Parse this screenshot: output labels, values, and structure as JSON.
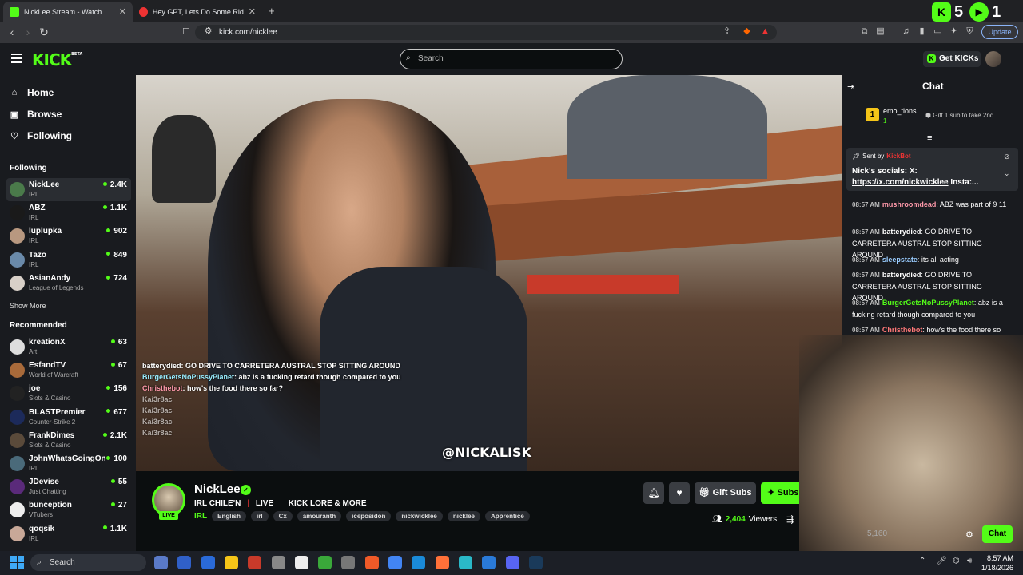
{
  "browser": {
    "tabs": [
      {
        "title": "NickLee Stream - Watch Live",
        "active": true
      },
      {
        "title": "Hey GPT, Lets Do Some Riddles - You",
        "active": false
      }
    ],
    "url": "kick.com/nicklee",
    "update_label": "Update",
    "new_tab_label": "+",
    "overlay_counts": [
      "5",
      "1"
    ]
  },
  "header": {
    "logo": "KICK",
    "logo_beta": "BETA",
    "search_placeholder": "Search",
    "get_kicks_label": "Get KICKs"
  },
  "sidebar": {
    "nav": [
      {
        "label": "Home",
        "icon": "home-icon"
      },
      {
        "label": "Browse",
        "icon": "browse-icon"
      },
      {
        "label": "Following",
        "icon": "heart-icon"
      }
    ],
    "following_title": "Following",
    "following": [
      {
        "name": "NickLee",
        "category": "IRL",
        "viewers": "2.4K",
        "active": true,
        "color": "#4a7a4a"
      },
      {
        "name": "ABZ",
        "category": "IRL",
        "viewers": "1.1K",
        "color": "#1a1a1a"
      },
      {
        "name": "luplupka",
        "category": "IRL",
        "viewers": "902",
        "color": "#b89880"
      },
      {
        "name": "Tazo",
        "category": "IRL",
        "viewers": "849",
        "color": "#6a8aaa"
      },
      {
        "name": "AsianAndy",
        "category": "League of Legends",
        "viewers": "724",
        "color": "#d8d0c8"
      }
    ],
    "show_more": "Show More",
    "recommended_title": "Recommended",
    "recommended": [
      {
        "name": "kreationX",
        "category": "Art",
        "viewers": "63",
        "color": "#ddd"
      },
      {
        "name": "EsfandTV",
        "category": "World of Warcraft",
        "viewers": "67",
        "color": "#a86a3a"
      },
      {
        "name": "joe",
        "category": "Slots & Casino",
        "viewers": "156",
        "color": "#222"
      },
      {
        "name": "BLASTPremier",
        "category": "Counter-Strike 2",
        "viewers": "677",
        "color": "#1c2a5a"
      },
      {
        "name": "FrankDimes",
        "category": "Slots & Casino",
        "viewers": "2.1K",
        "color": "#5a4a3a"
      },
      {
        "name": "JohnWhatsGoingOn",
        "category": "IRL",
        "viewers": "100",
        "color": "#4a6a7a"
      },
      {
        "name": "JDevise",
        "category": "Just Chatting",
        "viewers": "55",
        "color": "#5a2a7a"
      },
      {
        "name": "bunception",
        "category": "VTubers",
        "viewers": "27",
        "color": "#eee"
      },
      {
        "name": "qoqsik",
        "category": "IRL",
        "viewers": "1.1K",
        "color": "#c8a898"
      }
    ]
  },
  "video": {
    "overlay_chat": [
      {
        "user": "batterydied",
        "text": "GO DRIVE TO CARRETERA AUSTRAL STOP SITTING AROUND"
      },
      {
        "user": "BurgerGetsNoPussyPlanet",
        "text": "abz is a fucking retard though compared to you"
      },
      {
        "user": "Christhebot",
        "text": "how's the food there so far?"
      },
      {
        "user": "Kai3r8ac",
        "text": ""
      },
      {
        "user": "Kai3r8ac",
        "text": ""
      },
      {
        "user": "Kai3r8ac",
        "text": ""
      },
      {
        "user": "Kai3r8ac",
        "text": ""
      }
    ],
    "watermark": "@NICKALISK"
  },
  "stream": {
    "name": "NickLee",
    "live_badge": "LIVE",
    "title_parts": [
      "IRL CHILE'N",
      "LIVE",
      "KICK LORE & MORE"
    ],
    "category": "IRL",
    "tags": [
      "English",
      "irl",
      "Cx",
      "amouranth",
      "iceposidon",
      "nickwicklee",
      "nicklee",
      "Apprentice"
    ],
    "gift_subs_label": "Gift Subs",
    "subscribe_label": "Subscribe",
    "viewers": "2,404",
    "viewers_label": "Viewers"
  },
  "chat": {
    "title": "Chat",
    "top_gifter": {
      "rank": "1",
      "name": "emo_tions",
      "count": "1"
    },
    "gift_cta": "Gift 1 sub to take 2nd",
    "pinned": {
      "sent_by": "Sent by",
      "bot": "KickBot",
      "text": "Nick's socials: X: ",
      "link": "https://x.com/nickwicklee",
      "suffix": " Insta:..."
    },
    "messages": [
      {
        "time": "08:57 AM",
        "user": "mushroomdead",
        "text": "ABZ was part of 9 11",
        "color": "#f9a"
      },
      {
        "time": "08:57 AM",
        "user": "batterydied",
        "text": "GO DRIVE TO CARRETERA AUSTRAL STOP SITTING AROUND",
        "color": "#fff"
      },
      {
        "time": "08:57 AM",
        "user": "sleepstate",
        "text": "its all acting",
        "color": "#9cf"
      },
      {
        "time": "08:57 AM",
        "user": "batterydied",
        "text": "GO DRIVE TO CARRETERA AUSTRAL STOP SITTING AROUND",
        "color": "#fff"
      },
      {
        "time": "08:57 AM",
        "user": "BurgerGetsNoPussyPlanet",
        "text": "abz is a fucking retard though compared to you",
        "color": "#53fc18"
      },
      {
        "time": "08:57 AM",
        "user": "Christhebot",
        "text": "how's the food there so far?",
        "color": "#f77"
      },
      {
        "time": "08:57 AM",
        "user": "",
        "text": "",
        "color": "#fff"
      }
    ],
    "count": "5,160",
    "chat_button": "Chat"
  },
  "taskbar": {
    "search_placeholder": "Search",
    "time": "8:57 AM",
    "date": "1/18/2026"
  }
}
